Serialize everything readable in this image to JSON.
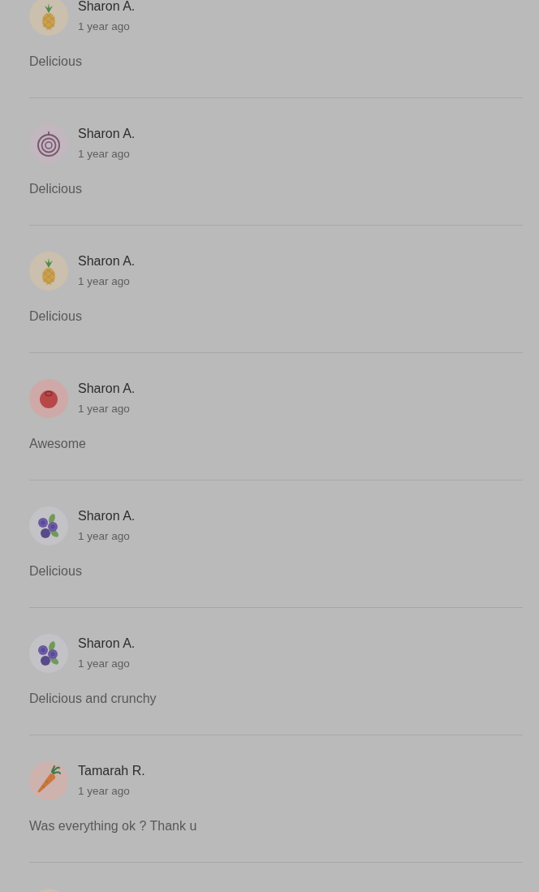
{
  "reviews": [
    {
      "avatar": {
        "kind": "pineapple"
      },
      "name": "Sharon A.",
      "time": "1 year ago",
      "comment": "Delicious"
    },
    {
      "avatar": {
        "kind": "onion"
      },
      "name": "Sharon A.",
      "time": "1 year ago",
      "comment": "Delicious"
    },
    {
      "avatar": {
        "kind": "pineapple"
      },
      "name": "Sharon A.",
      "time": "1 year ago",
      "comment": "Delicious"
    },
    {
      "avatar": {
        "kind": "tomato"
      },
      "name": "Sharon A.",
      "time": "1 year ago",
      "comment": "Awesome"
    },
    {
      "avatar": {
        "kind": "blueberries"
      },
      "name": "Sharon A.",
      "time": "1 year ago",
      "comment": "Delicious"
    },
    {
      "avatar": {
        "kind": "blueberries"
      },
      "name": "Sharon A.",
      "time": "1 year ago",
      "comment": "Delicious and crunchy"
    },
    {
      "avatar": {
        "kind": "carrot"
      },
      "name": "Tamarah R.",
      "time": "1 year ago",
      "comment": "Was everything ok ? Thank u"
    },
    {
      "avatar": {
        "kind": "pineapple"
      }
    }
  ]
}
